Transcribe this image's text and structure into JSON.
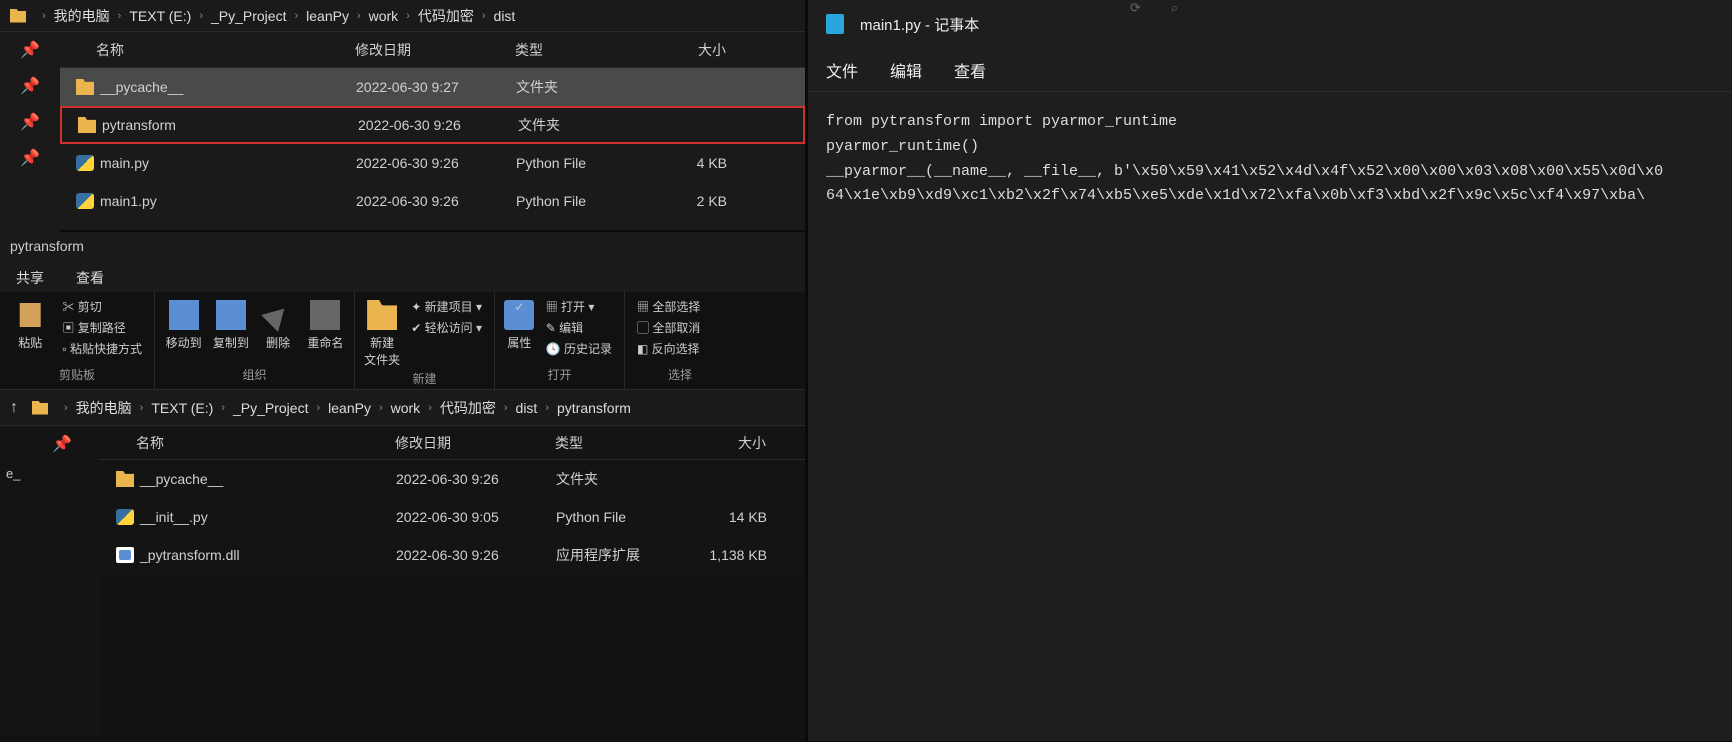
{
  "win1": {
    "breadcrumb": [
      "我的电脑",
      "TEXT (E:)",
      "_Py_Project",
      "leanPy",
      "work",
      "代码加密",
      "dist"
    ],
    "cols": {
      "name": "名称",
      "date": "修改日期",
      "type": "类型",
      "size": "大小"
    },
    "sort_indicator": "ˇ",
    "rows": [
      {
        "icon": "folder",
        "name": "__pycache__",
        "date": "2022-06-30 9:27",
        "type": "文件夹",
        "size": "",
        "sel": true
      },
      {
        "icon": "folder",
        "name": "pytransform",
        "date": "2022-06-30 9:26",
        "type": "文件夹",
        "size": "",
        "hi": true
      },
      {
        "icon": "py",
        "name": "main.py",
        "date": "2022-06-30 9:26",
        "type": "Python File",
        "size": "4 KB"
      },
      {
        "icon": "py",
        "name": "main1.py",
        "date": "2022-06-30 9:26",
        "type": "Python File",
        "size": "2 KB"
      }
    ]
  },
  "win2": {
    "title": "pytransform",
    "tabs": [
      "共享",
      "查看"
    ],
    "ribbon": {
      "paste": "粘贴",
      "cut": "剪切",
      "copypath": "复制路径",
      "pastelnk": "粘贴快捷方式",
      "moveto": "移动到",
      "copyto": "复制到",
      "delete": "删除",
      "rename": "重命名",
      "newfolder": "新建\n文件夹",
      "newitem": "新建项目",
      "easyaccess": "轻松访问",
      "props": "属性",
      "open": "打开",
      "edit": "编辑",
      "history": "历史记录",
      "selall": "全部选择",
      "selnone": "全部取消",
      "selinv": "反向选择",
      "g_clipboard": "剪贴板",
      "g_organize": "组织",
      "g_new": "新建",
      "g_open": "打开",
      "g_select": "选择"
    },
    "breadcrumb": [
      "我的电脑",
      "TEXT (E:)",
      "_Py_Project",
      "leanPy",
      "work",
      "代码加密",
      "dist",
      "pytransform"
    ],
    "left_sel": "e_",
    "cols": {
      "name": "名称",
      "date": "修改日期",
      "type": "类型",
      "size": "大小"
    },
    "rows": [
      {
        "icon": "folder",
        "name": "__pycache__",
        "date": "2022-06-30 9:26",
        "type": "文件夹",
        "size": ""
      },
      {
        "icon": "py",
        "name": "__init__.py",
        "date": "2022-06-30 9:05",
        "type": "Python File",
        "size": "14 KB"
      },
      {
        "icon": "dll",
        "name": "_pytransform.dll",
        "date": "2022-06-30 9:26",
        "type": "应用程序扩展",
        "size": "1,138 KB"
      }
    ]
  },
  "notepad": {
    "title": "main1.py - 记事本",
    "menus": [
      "文件",
      "编辑",
      "查看"
    ],
    "content": "from pytransform import pyarmor_runtime\npyarmor_runtime()\n__pyarmor__(__name__, __file__, b'\\x50\\x59\\x41\\x52\\x4d\\x4f\\x52\\x00\\x00\\x03\\x08\\x00\\x55\\x0d\\x0\n64\\x1e\\xb9\\xd9\\xc1\\xb2\\x2f\\x74\\xb5\\xe5\\xde\\x1d\\x72\\xfa\\x0b\\xf3\\xbd\\x2f\\x9c\\x5c\\xf4\\x97\\xba\\"
  },
  "tophints": {
    "refresh": "⟳",
    "search_icon": "⌕",
    "search_hint": ""
  }
}
